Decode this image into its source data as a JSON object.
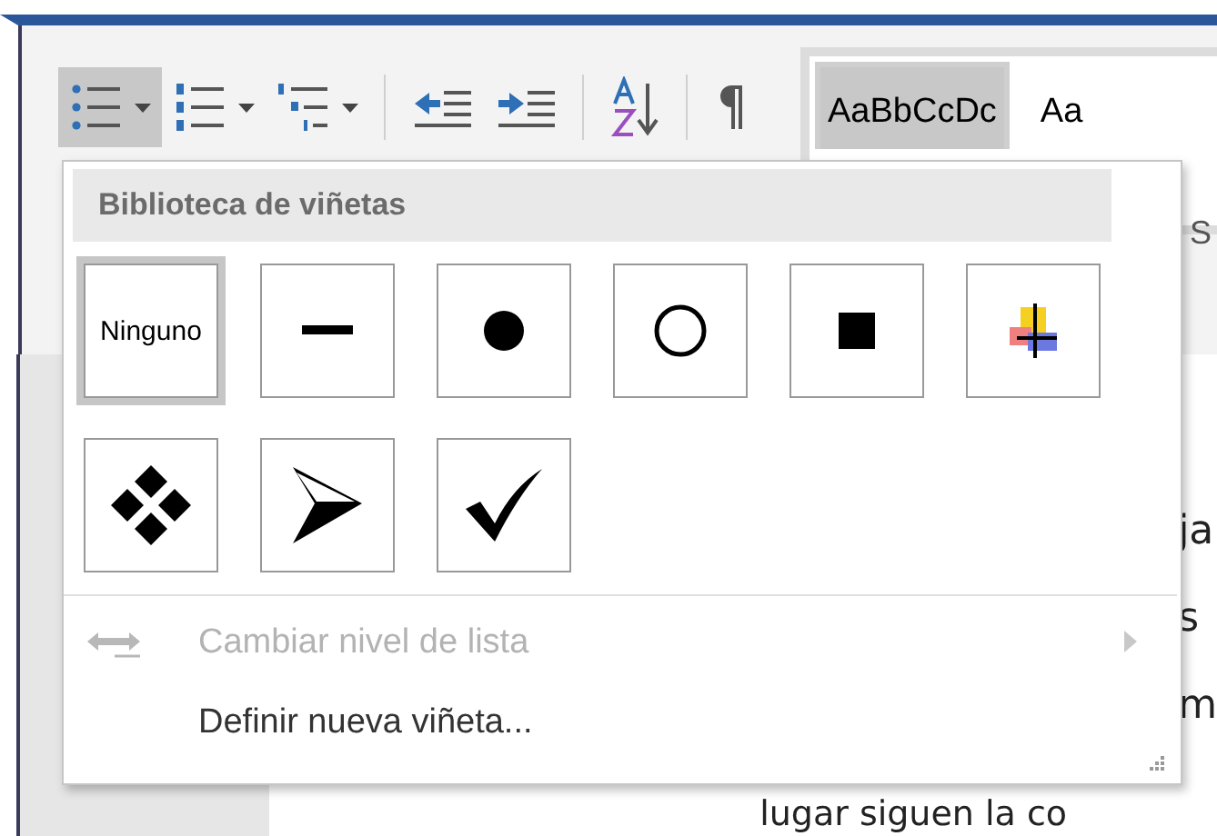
{
  "toolbar": {
    "buttons": [
      {
        "kind": "bullets",
        "selected": true,
        "dropdown": true
      },
      {
        "kind": "numbering",
        "selected": false,
        "dropdown": true
      },
      {
        "kind": "multilevel",
        "selected": false,
        "dropdown": true
      },
      {
        "kind": "outdent",
        "selected": false,
        "dropdown": false
      },
      {
        "kind": "indent",
        "selected": false,
        "dropdown": false
      },
      {
        "kind": "sort",
        "selected": false,
        "dropdown": false
      },
      {
        "kind": "pilcrow",
        "selected": false,
        "dropdown": false
      }
    ]
  },
  "styles": {
    "items": [
      {
        "label": "AaBbCcDc",
        "selected": true
      },
      {
        "label": "Aa",
        "selected": false
      }
    ],
    "caption": "S"
  },
  "menu": {
    "title": "Biblioteca de viñetas",
    "bullets": [
      {
        "kind": "none",
        "label": "Ninguno",
        "selected": true
      },
      {
        "kind": "dash",
        "selected": false
      },
      {
        "kind": "dot",
        "selected": false
      },
      {
        "kind": "circle",
        "selected": false
      },
      {
        "kind": "square",
        "selected": false
      },
      {
        "kind": "picture",
        "selected": false
      },
      {
        "kind": "diamonds",
        "selected": false
      },
      {
        "kind": "arrow",
        "selected": false
      },
      {
        "kind": "check",
        "selected": false
      }
    ],
    "items": [
      {
        "kind": "submenu",
        "label": "Cambiar nivel de lista",
        "disabled": true
      },
      {
        "kind": "plain",
        "label": "Definir nueva viñeta...",
        "disabled": false
      }
    ]
  },
  "document": {
    "lines": [
      "ja",
      "s",
      "m",
      "lugar siguen la co"
    ]
  }
}
